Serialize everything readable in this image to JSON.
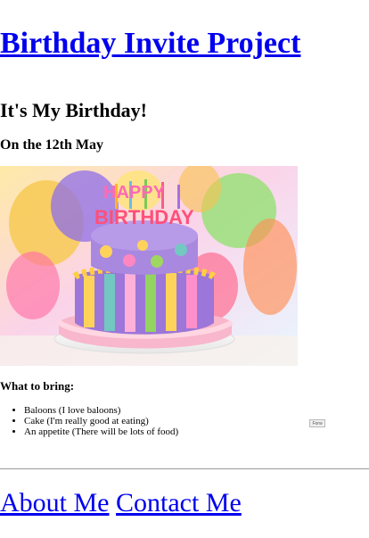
{
  "site": {
    "title": "Birthday Invite Project"
  },
  "invite": {
    "heading": "It's My Birthday!",
    "date": "On the 12th May",
    "image": {
      "alt": "Birthday cake",
      "cake_text_top": "HAPPY",
      "cake_text_bottom": "BIRTHDAY"
    },
    "bring_title": "What to bring:",
    "bring_items": [
      "Baloons (I love baloons)",
      "Cake (I'm really good at eating)",
      "An appetite (There will be lots of food)"
    ],
    "form_button_label": "Forw"
  },
  "footer": {
    "links": [
      "About Me",
      "Contact Me"
    ]
  },
  "colors": {
    "link": "#0000ee",
    "text": "#000000",
    "divider": "#999999"
  },
  "icons": {
    "bullet": "disc"
  }
}
